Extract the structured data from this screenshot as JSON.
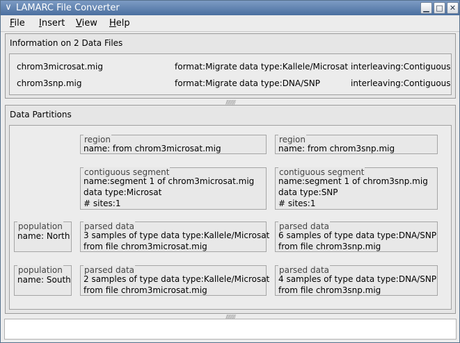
{
  "window": {
    "title": "LAMARC File Converter",
    "menu_icon": "chevron-down-icon",
    "minimize_icon": "minimize-icon",
    "maximize_icon": "maximize-icon",
    "close_icon": "close-icon"
  },
  "menubar": {
    "items": [
      "File",
      "Insert",
      "View",
      "Help"
    ]
  },
  "files_panel": {
    "title": "Information on 2 Data Files",
    "files": [
      {
        "name": "chrom3microsat.mig",
        "format": "format:Migrate",
        "data_type": "data type:Kallele/Microsat",
        "interleaving": "interleaving:Contiguous"
      },
      {
        "name": "chrom3snp.mig",
        "format": "format:Migrate",
        "data_type": "data type:DNA/SNP",
        "interleaving": "interleaving:Contiguous"
      }
    ]
  },
  "partitions_panel": {
    "title": "Data Partitions",
    "regions": [
      {
        "label": "region",
        "name": "name: from chrom3microsat.mig"
      },
      {
        "label": "region",
        "name": "name: from chrom3snp.mig"
      }
    ],
    "segments": [
      {
        "label": "contiguous segment",
        "name": "name:segment 1 of chrom3microsat.mig",
        "data_type": "data type:Microsat",
        "sites": "# sites:1"
      },
      {
        "label": "contiguous segment",
        "name": "name:segment 1 of chrom3snp.mig",
        "data_type": "data type:SNP",
        "sites": "# sites:1"
      }
    ],
    "populations": [
      {
        "label": "population",
        "name": "name: North"
      },
      {
        "label": "population",
        "name": "name: South"
      }
    ],
    "parsed": [
      {
        "label": "parsed data",
        "samples": "3 samples of type data type:Kallele/Microsat",
        "source": "from file chrom3microsat.mig"
      },
      {
        "label": "parsed data",
        "samples": "6 samples of type data type:DNA/SNP",
        "source": "from file chrom3snp.mig"
      },
      {
        "label": "parsed data",
        "samples": "2 samples of type data type:Kallele/Microsat",
        "source": "from file chrom3microsat.mig"
      },
      {
        "label": "parsed data",
        "samples": "4 samples of type data type:DNA/SNP",
        "source": "from file chrom3snp.mig"
      }
    ]
  }
}
